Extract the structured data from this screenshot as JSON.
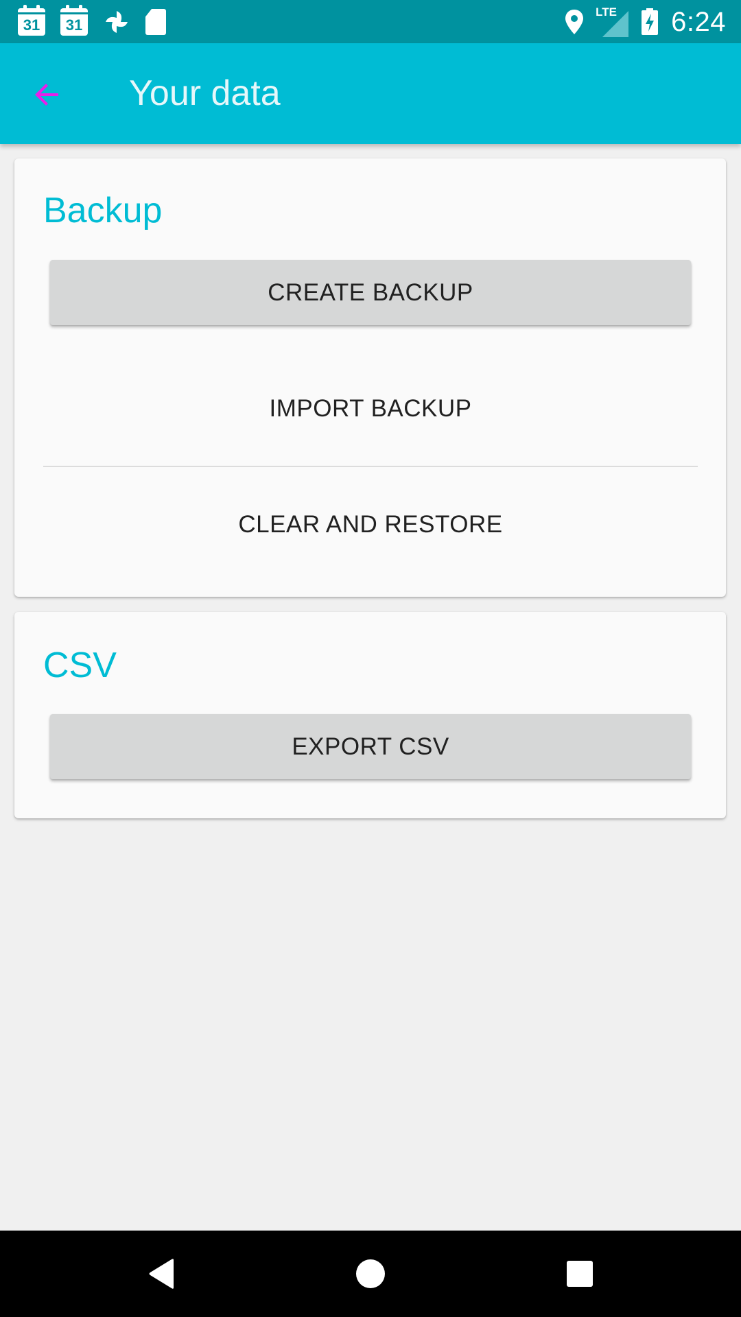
{
  "status_bar": {
    "calendar_day_1": "31",
    "calendar_day_2": "31",
    "network_type": "LTE",
    "time": "6:24"
  },
  "app_bar": {
    "title": "Your data",
    "back_icon_color": "#e91ee9"
  },
  "backup_section": {
    "title": "Backup",
    "create_backup_label": "CREATE BACKUP",
    "import_backup_label": "IMPORT BACKUP",
    "clear_and_restore_label": "CLEAR AND RESTORE"
  },
  "csv_section": {
    "title": "CSV",
    "export_csv_label": "EXPORT CSV"
  },
  "colors": {
    "status_bar": "#00929f",
    "app_bar": "#00bcd4",
    "accent": "#00bcd4",
    "back_arrow": "#e91ee9"
  },
  "nav_bar": {
    "icons": [
      "back-triangle-icon",
      "home-circle-icon",
      "recents-square-icon"
    ]
  }
}
